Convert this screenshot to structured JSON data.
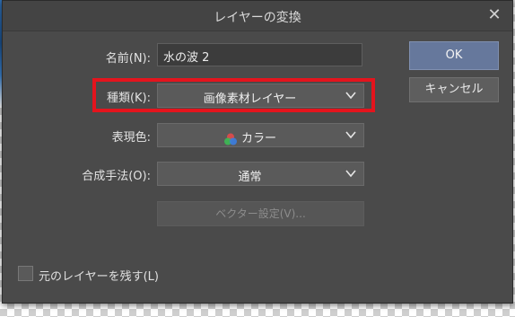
{
  "dialog": {
    "title": "レイヤーの変換",
    "close_symbol": "✕"
  },
  "fields": {
    "name_label": "名前(N):",
    "name_value": "水の波 2",
    "type_label": "種類(K):",
    "type_value": "画像素材レイヤー",
    "expression_label": "表現色:",
    "expression_value": "カラー",
    "blend_label": "合成手法(O):",
    "blend_value": "通常"
  },
  "buttons": {
    "ok": "OK",
    "cancel": "キャンセル",
    "vector_settings": "ベクター設定(V)..."
  },
  "checkbox": {
    "label": "元のレイヤーを残す(L)",
    "checked": false
  },
  "colors": {
    "highlight_border": "#e4141d",
    "ok_button": "#66789c",
    "dialog_bg": "#4a4a4a"
  },
  "icons": [
    "close-icon",
    "chevron-down-icon",
    "color-mode-icon"
  ]
}
